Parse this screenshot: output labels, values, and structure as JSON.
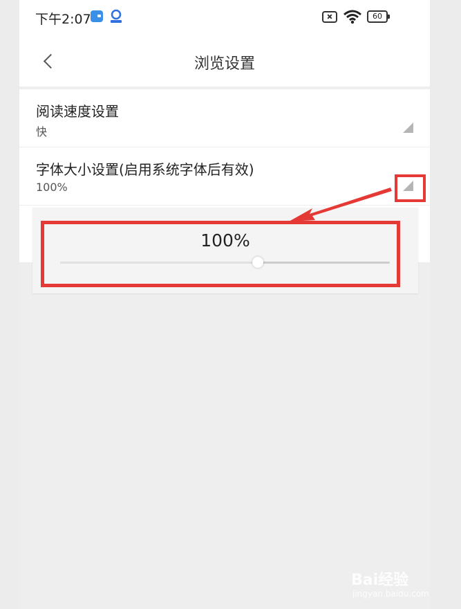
{
  "status_bar": {
    "time": "下午2:07",
    "battery_level": "60"
  },
  "header": {
    "title": "浏览设置"
  },
  "settings": [
    {
      "title": "阅读速度设置",
      "value": "快"
    },
    {
      "title": "字体大小设置(启用系统字体后有效)",
      "value": "100%"
    }
  ],
  "font_size_popup": {
    "value_label": "100%",
    "slider_fraction": 0.6
  },
  "colors": {
    "highlight": "#e53935"
  },
  "watermark": {
    "brand": "Bai经验",
    "url": "jingyan.baidu.com"
  }
}
